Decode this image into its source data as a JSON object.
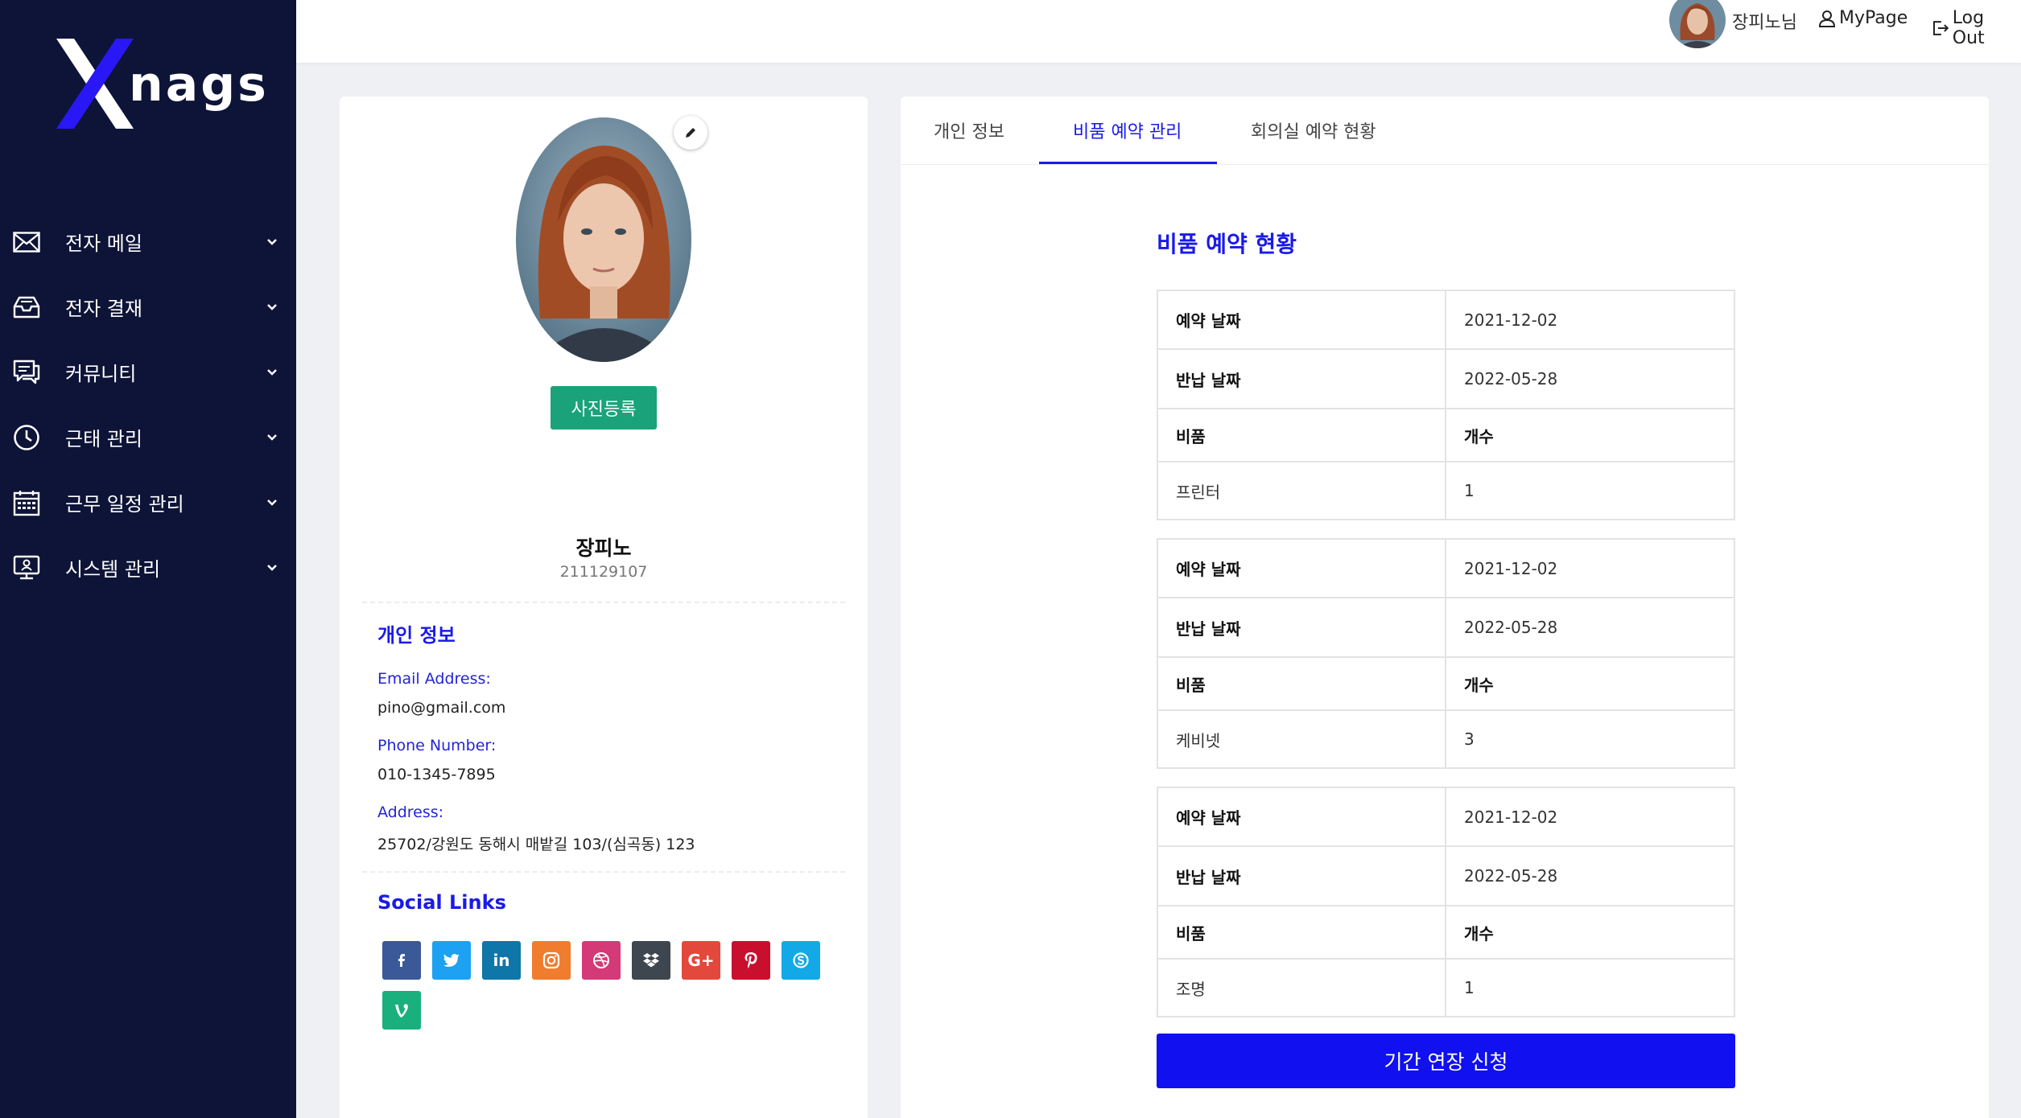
{
  "brand": {
    "logo_text": "nags",
    "logo_letter": "X"
  },
  "sidebar": {
    "items": [
      {
        "label": "전자 메일",
        "icon": "mail-icon"
      },
      {
        "label": "전자 결재",
        "icon": "inbox-tray-icon"
      },
      {
        "label": "커뮤니티",
        "icon": "chat-bubbles-icon"
      },
      {
        "label": "근태 관리",
        "icon": "clock-icon"
      },
      {
        "label": "근무 일정 관리",
        "icon": "calendar-icon"
      },
      {
        "label": "시스템 관리",
        "icon": "monitor-user-icon"
      }
    ]
  },
  "topbar": {
    "user_name": "장피노님",
    "mypage_label": "MyPage",
    "logout_label": "Log Out"
  },
  "profile": {
    "upload_button": "사진등록",
    "name": "장피노",
    "id": "211129107",
    "personal_title": "개인 정보",
    "email_label": "Email Address:",
    "email_value": "pino@gmail.com",
    "phone_label": "Phone Number:",
    "phone_value": "010-1345-7895",
    "address_label": "Address:",
    "address_value": "25702/강원도 동해시 매밭길 103/(심곡동) 123",
    "social_title": "Social Links",
    "social_links": [
      {
        "name": "facebook",
        "glyph": "f",
        "color": "#3b5998"
      },
      {
        "name": "twitter",
        "glyph": "t",
        "color": "#1da1f2"
      },
      {
        "name": "linkedin",
        "glyph": "in",
        "color": "#0e76a8"
      },
      {
        "name": "instagram",
        "glyph": "◎",
        "color": "#f07c2e"
      },
      {
        "name": "dribbble",
        "glyph": "◍",
        "color": "#d43a78"
      },
      {
        "name": "dropbox",
        "glyph": "◆",
        "color": "#3e4650"
      },
      {
        "name": "google-plus",
        "glyph": "G+",
        "color": "#e2483b"
      },
      {
        "name": "pinterest",
        "glyph": "P",
        "color": "#c8102e"
      },
      {
        "name": "skype",
        "glyph": "S",
        "color": "#12a9e6"
      },
      {
        "name": "vine",
        "glyph": "V",
        "color": "#1ab07e"
      }
    ]
  },
  "tabs": [
    {
      "label": "개인 정보",
      "active": false
    },
    {
      "label": "비품 예약 관리",
      "active": true
    },
    {
      "label": "회의실 예약 현황",
      "active": false
    }
  ],
  "reservations": {
    "title": "비품 예약 현황",
    "labels": {
      "reserve_date": "예약 날짜",
      "return_date": "반납 날짜",
      "item": "비품",
      "count": "개수"
    },
    "records": [
      {
        "reserve_date": "2021-12-02",
        "return_date": "2022-05-28",
        "item": "프린터",
        "count": "1"
      },
      {
        "reserve_date": "2021-12-02",
        "return_date": "2022-05-28",
        "item": "케비넷",
        "count": "3"
      },
      {
        "reserve_date": "2021-12-02",
        "return_date": "2022-05-28",
        "item": "조명",
        "count": "1"
      }
    ],
    "extend_button": "기간 연장 신청"
  }
}
